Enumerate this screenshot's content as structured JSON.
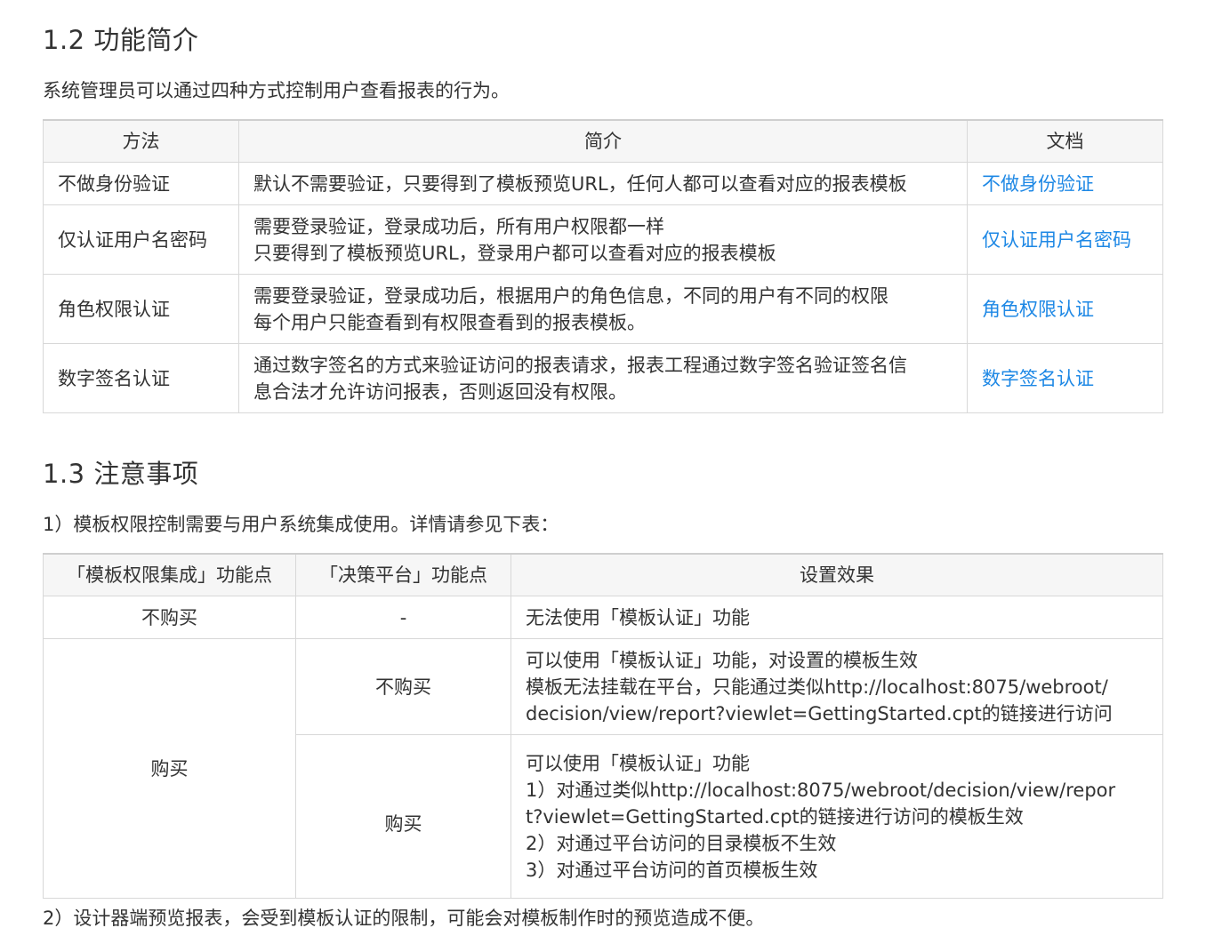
{
  "section1": {
    "heading": "1.2 功能简介",
    "intro": "系统管理员可以通过四种方式控制用户查看报表的行为。",
    "table": {
      "headers": [
        "方法",
        "简介",
        "文档"
      ],
      "rows": [
        {
          "method": "不做身份验证",
          "desc": [
            "默认不需要验证，只要得到了模板预览URL，任何人都可以查看对应的报表模板"
          ],
          "doc": "不做身份验证"
        },
        {
          "method": "仅认证用户名密码",
          "desc": [
            "需要登录验证，登录成功后，所有用户权限都一样",
            "只要得到了模板预览URL，登录用户都可以查看对应的报表模板"
          ],
          "doc": "仅认证用户名密码"
        },
        {
          "method": "角色权限认证",
          "desc": [
            "需要登录验证，登录成功后，根据用户的角色信息，不同的用户有不同的权限",
            "每个用户只能查看到有权限查看到的报表模板。"
          ],
          "doc": "角色权限认证"
        },
        {
          "method": "数字签名认证",
          "desc": [
            "通过数字签名的方式来验证访问的报表请求，报表工程通过数字签名验证签名信",
            "息合法才允许访问报表，否则返回没有权限。"
          ],
          "doc": "数字签名认证"
        }
      ]
    }
  },
  "section2": {
    "heading": "1.3 注意事项",
    "note1": "1）模板权限控制需要与用户系统集成使用。详情请参见下表：",
    "table": {
      "headers": [
        "「模板权限集成」功能点",
        "「决策平台」功能点",
        "设置效果"
      ],
      "row1": {
        "a": "不购买",
        "b": "-",
        "effect": [
          "无法使用「模板认证」功能"
        ]
      },
      "row2": {
        "a": "购买",
        "b": "不购买",
        "effect": [
          "可以使用「模板认证」功能，对设置的模板生效",
          "模板无法挂载在平台，只能通过类似http://localhost:8075/webroot/",
          "decision/view/report?viewlet=GettingStarted.cpt的链接进行访问"
        ]
      },
      "row3": {
        "b": "购买",
        "effect": [
          "可以使用「模板认证」功能",
          "1）对通过类似http://localhost:8075/webroot/decision/view/repor",
          "t?viewlet=GettingStarted.cpt的链接进行访问的模板生效",
          "2）对通过平台访问的目录模板不生效",
          "3）对通过平台访问的首页模板生效"
        ]
      }
    },
    "note2": "2）设计器端预览报表，会受到模板认证的限制，可能会对模板制作时的预览造成不便。"
  },
  "colors": {
    "link": "#1e88e5",
    "header_bg": "#f6f6f6",
    "border": "#d8d8d8",
    "text": "#333333"
  }
}
